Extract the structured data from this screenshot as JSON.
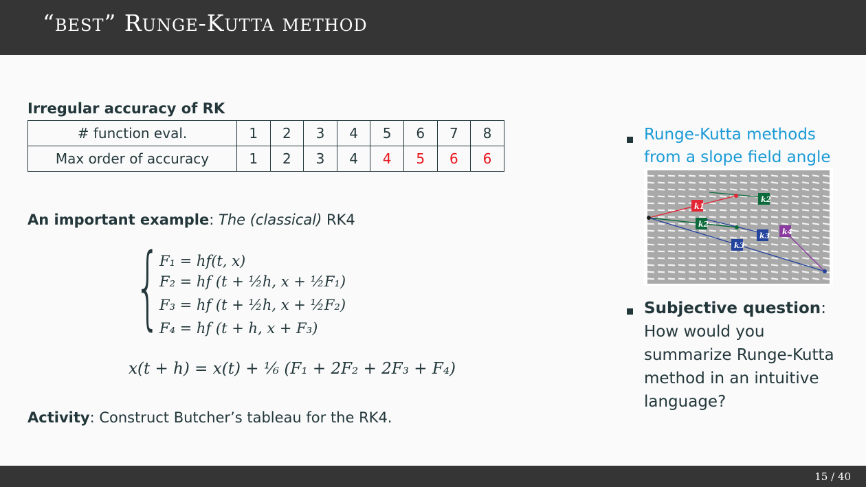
{
  "slide": {
    "title_quote_open": "“",
    "title_best": "best",
    "title_quote_close": "”",
    "title_r": "R",
    "title_unge": "unge",
    "title_dash_k": "-K",
    "title_utta": "utta",
    "title_method": "method",
    "page_number": "15 / 40"
  },
  "table": {
    "heading": "Irregular accuracy of RK",
    "row1_label": "# function eval.",
    "row1_values": [
      "1",
      "2",
      "3",
      "4",
      "5",
      "6",
      "7",
      "8"
    ],
    "row2_label": "Max order of accuracy",
    "row2_values": [
      "1",
      "2",
      "3",
      "4",
      "4",
      "5",
      "6",
      "6"
    ],
    "highlight_color": "#e8141c"
  },
  "example": {
    "label_bold": "An important example",
    "separator": ": ",
    "italic_text": "The (classical)",
    "plain_text": " RK4"
  },
  "equations": {
    "F1": "F₁ = hf(t, x)",
    "F2": "F₂ = hf (t + ½h, x + ½F₁)",
    "F3": "F₃ = hf (t + ½h, x + ½F₂)",
    "F4": "F₄ = hf (t + h, x + F₃)",
    "update": "x(t + h) = x(t) + ⅙ (F₁ + 2F₂ + 2F₃ + F₄)"
  },
  "activity": {
    "label_bold": "Activity",
    "text": ": Construct Butcher’s tableau for the RK4."
  },
  "bullets": {
    "first_line1": "Runge-Kutta methods",
    "first_line2": "from a slope field angle",
    "first_color": "#1a9ad6",
    "second_bold": "Subjective question",
    "second_colon": ":",
    "second_text": "How would you summarize Runge-Kutta method in an intuitive language?"
  },
  "figure": {
    "labels": [
      "k1",
      "k2",
      "k2",
      "k3",
      "k3",
      "k4"
    ],
    "colors": {
      "k1": "#e32636",
      "k2": "#0b6b3a",
      "k3": "#24439c",
      "k4": "#8a3c9e"
    }
  }
}
